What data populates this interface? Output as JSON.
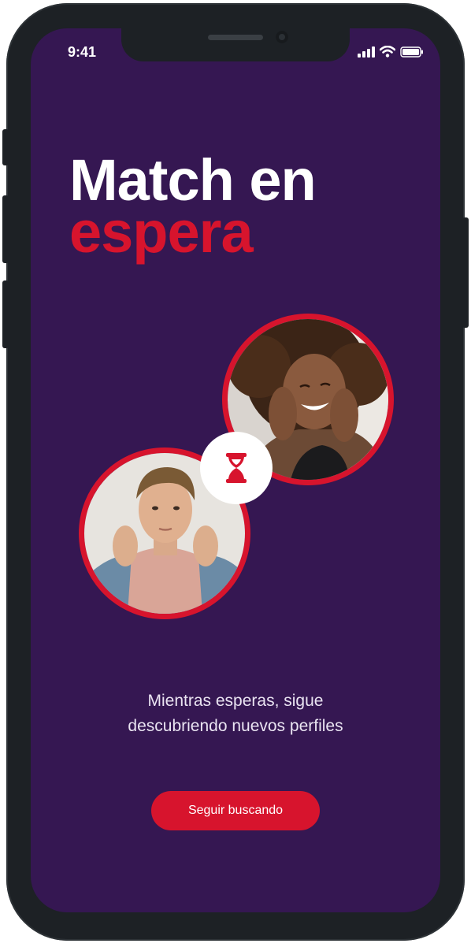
{
  "status_bar": {
    "time": "9:41"
  },
  "header": {
    "title_line1": "Match en",
    "title_line2": "espera"
  },
  "match": {
    "photo_right": "smiling-woman-photo",
    "photo_left": "man-in-hoodie-photo",
    "center_icon": "hourglass-icon"
  },
  "message": {
    "line1": "Mientras esperas, sigue",
    "line2": "descubriendo nuevos perfiles"
  },
  "cta": {
    "label": "Seguir buscando"
  },
  "colors": {
    "background": "#351752",
    "accent": "#d7142d",
    "text": "#ffffff"
  }
}
